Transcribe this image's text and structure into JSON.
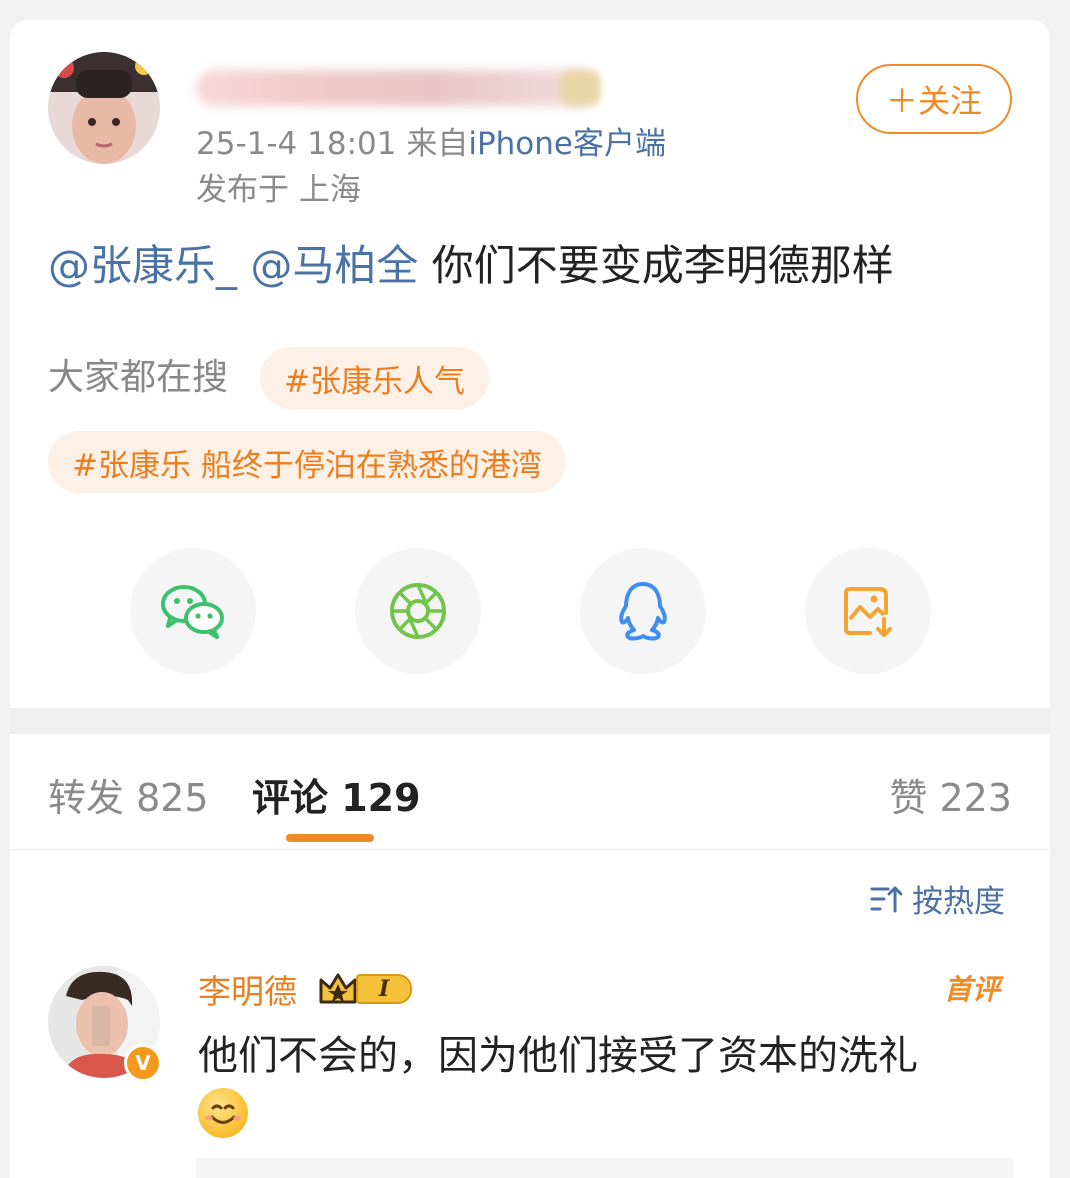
{
  "post": {
    "timestamp": "25-1-4 18:01",
    "from_label": "来自",
    "source": "iPhone客户端",
    "location": "发布于 上海",
    "follow_label": "＋关注",
    "mention1": "@张康乐_",
    "mention2": "@马柏全",
    "text": " 你们不要变成李明德那样"
  },
  "search": {
    "label": "大家都在搜",
    "tags": [
      "#张康乐人气",
      "#张康乐 船终于停泊在熟悉的港湾"
    ]
  },
  "share": {
    "icons": [
      "wechat-icon",
      "moments-icon",
      "qq-icon",
      "save-image-icon"
    ]
  },
  "tabs": {
    "repost": "转发 825",
    "comment": "评论 129",
    "like": "赞 223"
  },
  "sort": {
    "label": "按热度"
  },
  "comment": {
    "name": "李明德",
    "level": "I",
    "first_badge": "首评",
    "verified": "V",
    "text": "他们不会的，因为他们接受了资本的洗礼"
  },
  "colors": {
    "accent": "#f08a24",
    "link": "#4b72a6",
    "wechat": "#3ec06d",
    "moments": "#72c44a",
    "qq": "#3d8ef0",
    "save": "#f4a531"
  }
}
